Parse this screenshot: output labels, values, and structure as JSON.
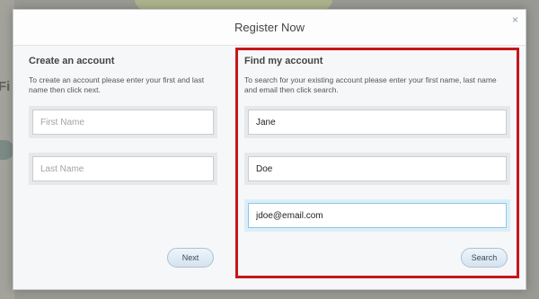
{
  "background": {
    "partial_heading": "Fi"
  },
  "modal": {
    "title": "Register Now",
    "close_label": "×"
  },
  "create_account": {
    "heading": "Create an account",
    "description": "To create an account please enter your first and last name then click next.",
    "first_name_placeholder": "First Name",
    "last_name_placeholder": "Last Name",
    "next_label": "Next"
  },
  "find_account": {
    "heading": "Find my account",
    "description": "To search for your existing account please enter your first name, last name and email then click search.",
    "first_name_value": "Jane",
    "last_name_value": "Doe",
    "email_value": "jdoe@email.com",
    "search_label": "Search"
  },
  "colors": {
    "highlight_border": "#c4171b",
    "focus_border": "#8ec7e6"
  }
}
